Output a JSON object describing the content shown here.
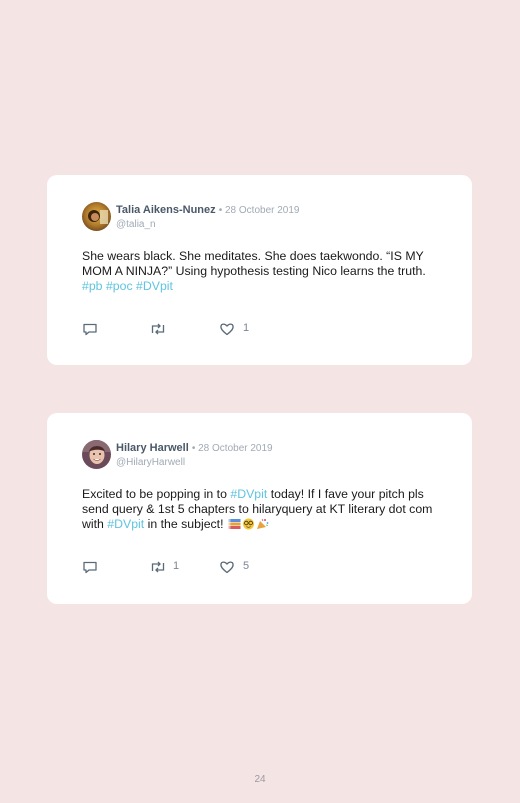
{
  "colors": {
    "page_bg": "#f5e4e4",
    "card_bg": "#ffffff",
    "hashtag": "#5ec4e0",
    "name": "#4a5868",
    "meta": "#a0aab4"
  },
  "tweets": [
    {
      "name": "Talia Aikens-Nunez",
      "date": "• 28 October 2019",
      "handle": "@talia_n",
      "text_main": "She wears black. She meditates. She does taekwondo. “IS MY MOM A NINJA?” Using hypothesis testing Nico learns the truth. ",
      "tags": [
        "#pb",
        "#poc",
        "#DVpit"
      ],
      "reply_count": "",
      "retweet_count": "",
      "like_count": "1",
      "icons": [
        "reply-icon",
        "retweet-icon",
        "heart-icon"
      ]
    },
    {
      "name": "Hilary Harwell",
      "date": "• 28 October 2019",
      "handle": "@HilaryHarwell",
      "text_part1": "Excited to be popping in to ",
      "tag1": "#DVpit",
      "text_part2": " today! If I fave your pitch pls send query & 1st 5 chapters to hilaryquery at KT literary dot com with ",
      "tag2": "#DVpit",
      "text_part3": " in the subject! ",
      "emojis": [
        "books-emoji",
        "nerd-face-emoji",
        "party-popper-emoji"
      ],
      "reply_count": "",
      "retweet_count": "1",
      "like_count": "5",
      "icons": [
        "reply-icon",
        "retweet-icon",
        "heart-icon"
      ]
    }
  ],
  "page_number": "24"
}
